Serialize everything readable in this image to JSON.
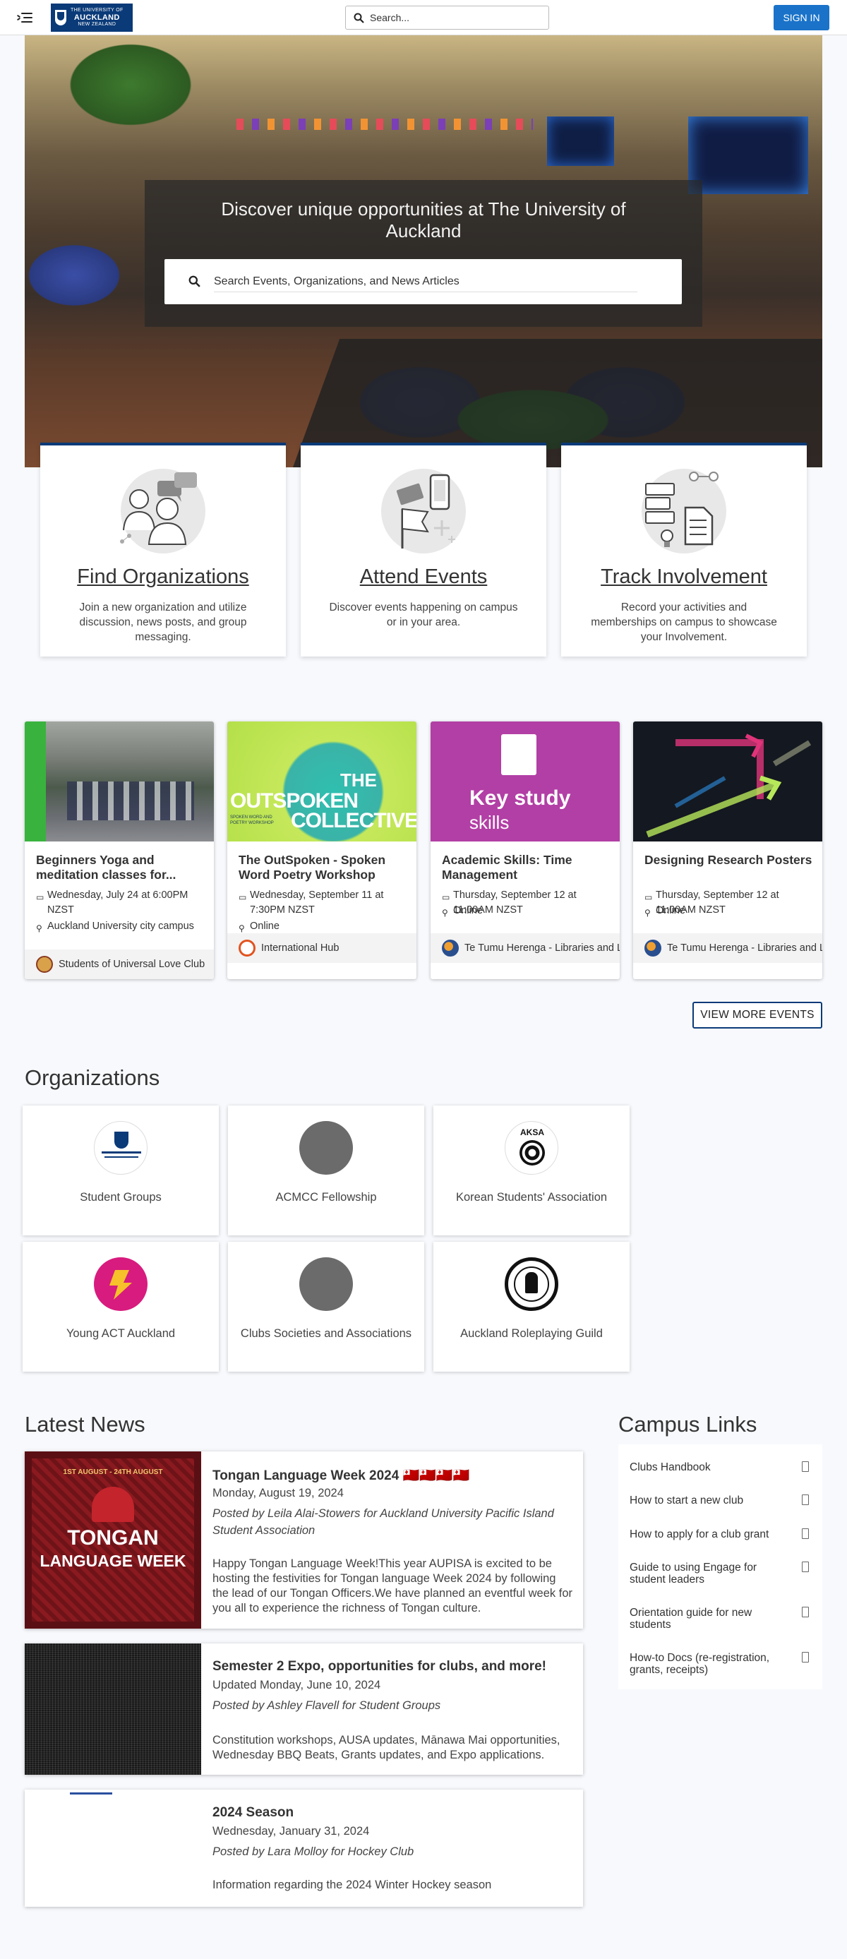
{
  "header": {
    "logo": {
      "line1": "THE UNIVERSITY OF",
      "line2": "AUCKLAND",
      "line3": "NEW ZEALAND"
    },
    "search_placeholder": "Search...",
    "sign_in": "SIGN IN"
  },
  "hero": {
    "title": "Discover unique opportunities at The University of Auckland",
    "search_placeholder": "Search Events, Organizations, and News Articles"
  },
  "features": [
    {
      "title": "Find Organizations",
      "desc": "Join a new organization and utilize discussion, news posts, and group messaging."
    },
    {
      "title": "Attend Events",
      "desc": "Discover events happening on campus or in your area."
    },
    {
      "title": "Track Involvement",
      "desc": "Record your activities and memberships on campus to showcase your Involvement."
    }
  ],
  "events": [
    {
      "title": "Beginners Yoga and meditation classes for...",
      "date": "Wednesday, July 24 at 6:00PM NZST",
      "location": "Auckland University city campus",
      "org": "Students of Universal Love Club"
    },
    {
      "title": "The OutSpoken - Spoken Word Poetry Workshop",
      "date": "Wednesday, September 11 at 7:30PM NZST",
      "location": "Online",
      "org": "International Hub",
      "image_text": {
        "line1": "THE",
        "line2": "OUTSPOKEN",
        "line3": "COLLECTIVE",
        "small": "SPOKEN WORD AND POETRY WORKSHOP"
      }
    },
    {
      "title": "Academic Skills: Time Management",
      "date": "Thursday, September 12 at 11:00AM NZST",
      "location": "Online",
      "org": "Te Tumu Herenga - Libraries and Learning Services",
      "image_text": {
        "line1": "Key study",
        "line2": "skills"
      }
    },
    {
      "title": "Designing Research Posters",
      "date": "Thursday, September 12 at 11:00AM NZST",
      "location": "Online",
      "org": "Te Tumu Herenga - Libraries and Learning Services"
    }
  ],
  "view_more_events": "VIEW MORE EVENTS",
  "organizations": {
    "title": "Organizations",
    "items": [
      {
        "name": "Student Groups"
      },
      {
        "name": "ACMCC Fellowship"
      },
      {
        "name": "Korean Students' Association",
        "logo_text": "AKSA"
      },
      {
        "name": "Young ACT Auckland"
      },
      {
        "name": "Clubs Societies and Associations"
      },
      {
        "name": "Auckland Roleplaying Guild"
      }
    ]
  },
  "news": {
    "title": "Latest News",
    "items": [
      {
        "title": "Tongan Language Week 2024 🇹🇴🇹🇴🇹🇴🇹🇴",
        "date": "Monday, August 19, 2024",
        "by": "Posted by Leila Alai-Stowers for Auckland University Pacific Island Student Association",
        "summary": "Happy Tongan Language Week!This year AUPISA is excited to be hosting the festivities for Tongan language Week 2024 by following the lead of our Tongan Officers.We have planned an eventful week for you all to experience the richness of Tongan culture.",
        "image_text": {
          "top": "1ST AUGUST - 24TH AUGUST",
          "line1": "TONGAN",
          "line2": "LANGUAGE WEEK"
        }
      },
      {
        "title": "Semester 2 Expo, opportunities for clubs, and more!",
        "date": "Updated Monday, June 10, 2024",
        "by": "Posted by Ashley Flavell for Student Groups",
        "summary": "Constitution workshops, AUSA updates, Mānawa Mai opportunities, Wednesday BBQ Beats, Grants updates, and Expo applications."
      },
      {
        "title": "2024 Season",
        "date": "Wednesday, January 31, 2024",
        "by": "Posted by Lara Molloy for Hockey Club",
        "summary": "Information regarding the 2024 Winter Hockey season"
      }
    ]
  },
  "campus_links": {
    "title": "Campus Links",
    "items": [
      {
        "label": "Clubs Handbook"
      },
      {
        "label": "How to start a new club"
      },
      {
        "label": "How to apply for a club grant"
      },
      {
        "label": "Guide to using Engage for student leaders"
      },
      {
        "label": "Orientation guide for new students"
      },
      {
        "label": "How-to Docs (re-registration, grants, receipts)"
      }
    ]
  },
  "colors": {
    "brand": "#0a3a78",
    "accent": "#1a73c9"
  }
}
